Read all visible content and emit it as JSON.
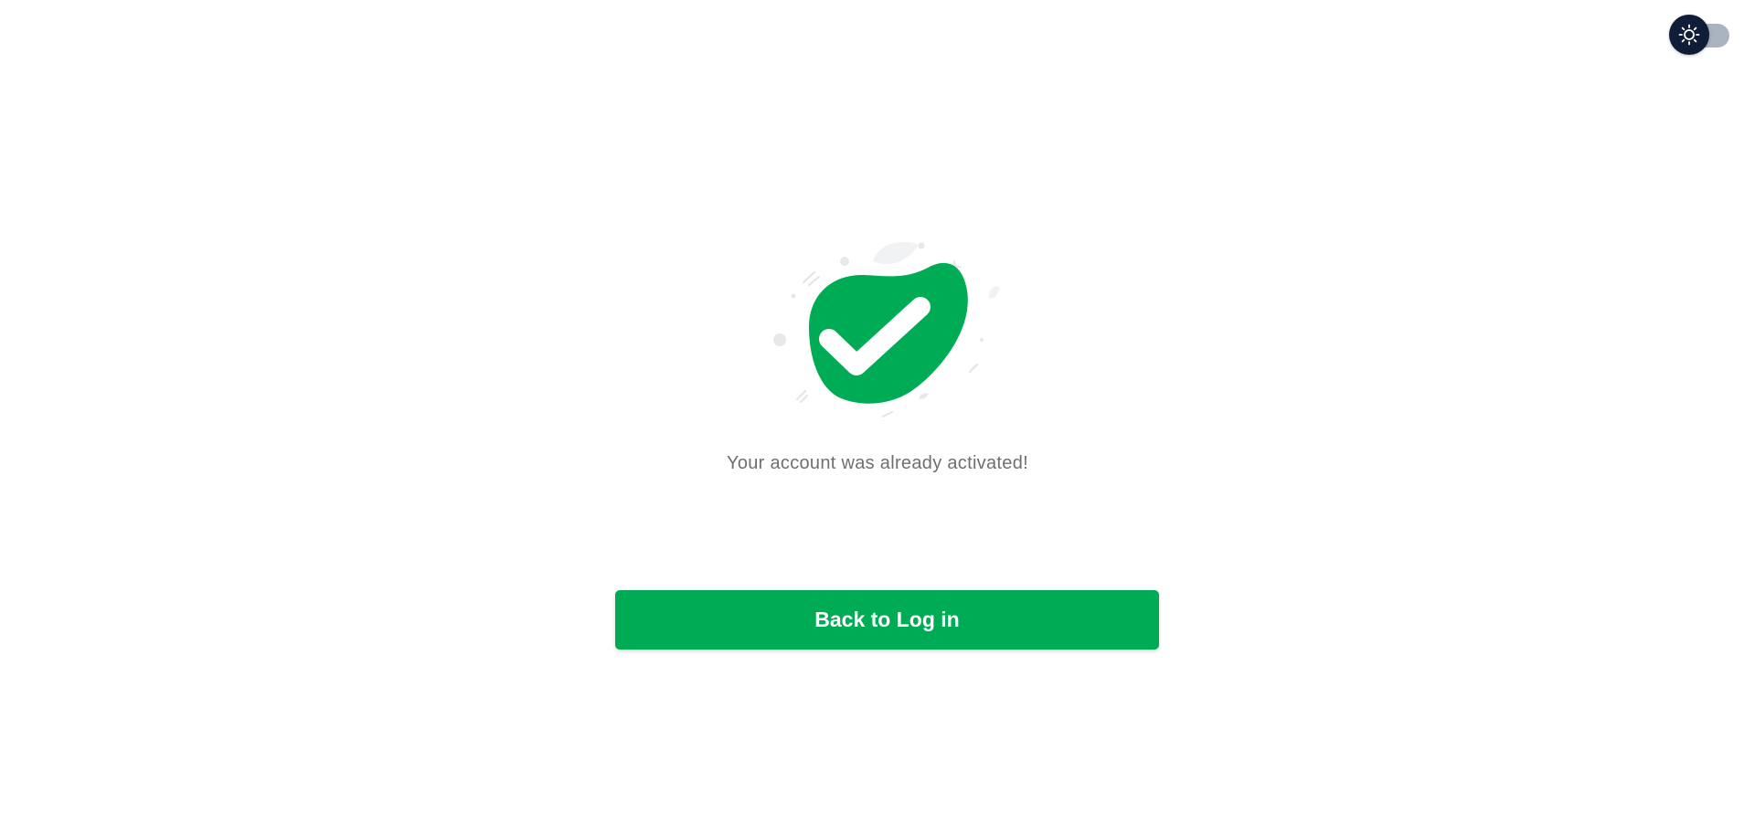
{
  "theme_toggle": {
    "icon": "sun-icon",
    "state": "light"
  },
  "illustration": {
    "icon": "check-badge-icon",
    "accent_color": "#00ab55"
  },
  "message": "Your account was already activated!",
  "back_button": {
    "label": "Back to Log in",
    "color": "#00ab55"
  }
}
